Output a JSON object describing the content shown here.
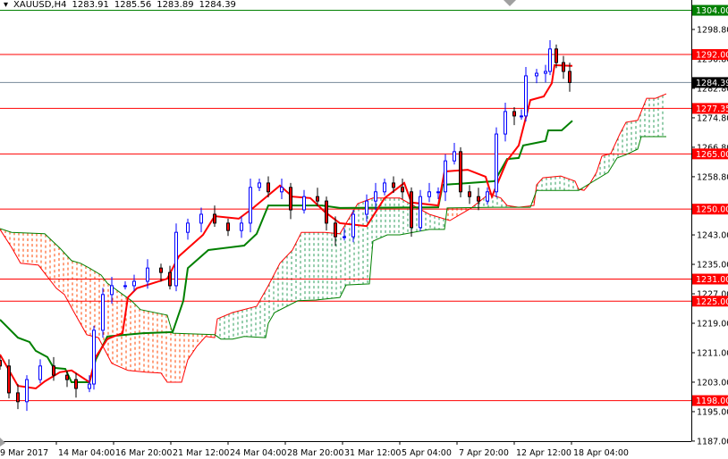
{
  "chart_data": {
    "type": "candlestick",
    "title": "XAUUSD,H4",
    "ohlc": [
      "1283.91",
      "1285.56",
      "1283.89",
      "1284.39"
    ],
    "ylim": [
      1185,
      1306.8
    ],
    "bar_count_visible": 130,
    "x_ticks": [
      "9 Mar 2017",
      "14 Mar 04:00",
      "16 Mar 20:00",
      "21 Mar 12:00",
      "24 Mar 04:00",
      "28 Mar 20:00",
      "31 Mar 12:00",
      "5 Apr 04:00",
      "7 Apr 20:00",
      "12 Apr 12:00",
      "18 Apr 04:00"
    ],
    "y_ticks": [
      "1298.80",
      "1290.80",
      "1282.80",
      "1274.80",
      "1266.80",
      "1258.80",
      "1243.00",
      "1235.00",
      "1227.00",
      "1219.00",
      "1211.00",
      "1203.00",
      "1195.00",
      "1187.00"
    ],
    "current_price": {
      "value": 1284.39,
      "label": "1284.39",
      "color": "#778899"
    },
    "levels": [
      {
        "value": 1304.0,
        "label": "1304.00",
        "color": "#008000"
      },
      {
        "value": 1292.0,
        "label": "1292.00",
        "color": "#ff0000"
      },
      {
        "value": 1277.35,
        "label": "1277.35",
        "color": "#ff0000"
      },
      {
        "value": 1265.0,
        "label": "1265.00",
        "color": "#ff0000"
      },
      {
        "value": 1250.0,
        "label": "1250.00",
        "color": "#ff0000"
      },
      {
        "value": 1231.0,
        "label": "1231.00",
        "color": "#ff0000"
      },
      {
        "value": 1225.0,
        "label": "1225.00",
        "color": "#ff0000"
      },
      {
        "value": 1198.0,
        "label": "1198.00",
        "color": "#ff0000"
      }
    ],
    "colors": {
      "bull": "#0000ff",
      "bear": "#ff0000",
      "tenkan": "#ff0000",
      "kijun": "#008000",
      "cloud_bull": "#2e9e5b",
      "cloud_bear": "#ff4500",
      "span_a": "#ff0000",
      "span_b": "#008000"
    },
    "closes": [
      [
        0,
        1207.4
      ],
      [
        2,
        1200.1
      ],
      [
        4,
        1197.7
      ],
      [
        6,
        1203.7
      ],
      [
        9,
        1207.4
      ],
      [
        12,
        1204.9
      ],
      [
        15,
        1203.7
      ],
      [
        17,
        1201.3
      ],
      [
        20,
        1202.5
      ],
      [
        21,
        1217.1
      ],
      [
        23,
        1226.8
      ],
      [
        25,
        1229.2
      ],
      [
        28,
        1229.2
      ],
      [
        30,
        1230.4
      ],
      [
        33,
        1234.0
      ],
      [
        36,
        1232.8
      ],
      [
        38,
        1229.2
      ],
      [
        39.4,
        1243.7
      ],
      [
        42,
        1246.2
      ],
      [
        45,
        1248.6
      ],
      [
        48,
        1246.2
      ],
      [
        51,
        1244.2
      ],
      [
        54,
        1246.2
      ],
      [
        56,
        1255.9
      ],
      [
        58,
        1257.1
      ],
      [
        60,
        1254.7
      ],
      [
        63,
        1255.9
      ],
      [
        65,
        1249.8
      ],
      [
        68,
        1253.4
      ],
      [
        71,
        1252.2
      ],
      [
        73,
        1246.2
      ],
      [
        75,
        1242.5
      ],
      [
        77,
        1242.5
      ],
      [
        79,
        1248.6
      ],
      [
        82,
        1252.2
      ],
      [
        84,
        1254.7
      ],
      [
        86,
        1257.1
      ],
      [
        88,
        1255.9
      ],
      [
        90,
        1254.7
      ],
      [
        92,
        1245.0
      ],
      [
        94,
        1253.4
      ],
      [
        96,
        1254.7
      ],
      [
        98,
        1254.7
      ],
      [
        99.6,
        1263.1
      ],
      [
        101.6,
        1265.6
      ],
      [
        103,
        1254.7
      ],
      [
        105,
        1253.4
      ],
      [
        107,
        1252.2
      ],
      [
        109,
        1254.7
      ],
      [
        111,
        1270.4
      ],
      [
        113,
        1276.5
      ],
      [
        115,
        1275.3
      ],
      [
        116.6,
        1275.3
      ],
      [
        117.6,
        1286.2
      ],
      [
        120,
        1286.9
      ],
      [
        122,
        1287.4
      ],
      [
        123,
        1293.5
      ],
      [
        124.4,
        1289.8
      ],
      [
        126,
        1287.4
      ],
      [
        127.4,
        1284.39
      ]
    ],
    "tenkan": [
      [
        0,
        1210.5
      ],
      [
        4,
        1202.0
      ],
      [
        8,
        1201.3
      ],
      [
        10,
        1203.2
      ],
      [
        13.4,
        1205.7
      ],
      [
        16,
        1206.2
      ],
      [
        20,
        1203.0
      ],
      [
        21.4,
        1209.8
      ],
      [
        24,
        1214.7
      ],
      [
        25.4,
        1215.4
      ],
      [
        27.4,
        1216.3
      ],
      [
        28.6,
        1226.0
      ],
      [
        30.6,
        1228.5
      ],
      [
        37.4,
        1231.1
      ],
      [
        40,
        1237.2
      ],
      [
        45.4,
        1243.0
      ],
      [
        48,
        1248.1
      ],
      [
        53.4,
        1247.4
      ],
      [
        56.6,
        1250.3
      ],
      [
        62.6,
        1256.4
      ],
      [
        65.4,
        1253.4
      ],
      [
        69.4,
        1253.0
      ],
      [
        72.6,
        1249.3
      ],
      [
        76,
        1246.2
      ],
      [
        82,
        1245.4
      ],
      [
        86,
        1253.0
      ],
      [
        90.4,
        1257.1
      ],
      [
        92,
        1251.8
      ],
      [
        98,
        1251.0
      ],
      [
        99.4,
        1260.2
      ],
      [
        104.6,
        1260.7
      ],
      [
        108.6,
        1258.8
      ],
      [
        110,
        1253.4
      ],
      [
        113.4,
        1263.2
      ],
      [
        116,
        1267.3
      ],
      [
        118.6,
        1279.6
      ],
      [
        121.6,
        1280.6
      ],
      [
        123.4,
        1284.2
      ],
      [
        124,
        1289.1
      ],
      [
        128,
        1288.9
      ]
    ],
    "kijun": [
      [
        0,
        1220.0
      ],
      [
        4,
        1215.1
      ],
      [
        6.6,
        1213.9
      ],
      [
        8,
        1211.5
      ],
      [
        10.6,
        1209.8
      ],
      [
        12,
        1206.9
      ],
      [
        14.6,
        1206.6
      ],
      [
        16,
        1203.0
      ],
      [
        20,
        1203.0
      ],
      [
        21.4,
        1209.1
      ],
      [
        24,
        1215.4
      ],
      [
        32,
        1216.3
      ],
      [
        38.6,
        1216.6
      ],
      [
        41,
        1225.1
      ],
      [
        42,
        1234.0
      ],
      [
        46.6,
        1238.9
      ],
      [
        54.6,
        1240.1
      ],
      [
        57.4,
        1243.3
      ],
      [
        60,
        1251.0
      ],
      [
        72,
        1251.0
      ],
      [
        76,
        1250.3
      ],
      [
        98,
        1250.5
      ],
      [
        99,
        1256.6
      ],
      [
        110.6,
        1257.6
      ],
      [
        113.4,
        1263.6
      ],
      [
        116,
        1263.9
      ],
      [
        117,
        1267.3
      ],
      [
        122,
        1268.5
      ],
      [
        122.6,
        1271.4
      ],
      [
        125.6,
        1271.4
      ],
      [
        128,
        1274.0
      ]
    ],
    "span_a": [
      [
        0,
        1244.5
      ],
      [
        2.6,
        1239.6
      ],
      [
        4.6,
        1235.3
      ],
      [
        8.6,
        1234.8
      ],
      [
        12.6,
        1228.5
      ],
      [
        14.4,
        1226.8
      ],
      [
        16.6,
        1221.9
      ],
      [
        19.4,
        1215.9
      ],
      [
        22,
        1215.1
      ],
      [
        25,
        1208.1
      ],
      [
        28.6,
        1206.2
      ],
      [
        32.6,
        1205.7
      ],
      [
        36,
        1205.5
      ],
      [
        37.4,
        1203.0
      ],
      [
        40.6,
        1203.0
      ],
      [
        42,
        1209.1
      ],
      [
        44,
        1212.7
      ],
      [
        46,
        1215.4
      ],
      [
        48,
        1215.1
      ],
      [
        48.6,
        1220.2
      ],
      [
        52,
        1221.9
      ],
      [
        57.4,
        1223.6
      ],
      [
        60,
        1229.2
      ],
      [
        62.6,
        1235.3
      ],
      [
        65.4,
        1238.9
      ],
      [
        67.4,
        1243.7
      ],
      [
        72.6,
        1243.7
      ],
      [
        76,
        1243.3
      ],
      [
        80,
        1251.5
      ],
      [
        83.4,
        1253.0
      ],
      [
        89.4,
        1253.0
      ],
      [
        96,
        1248.6
      ],
      [
        100.6,
        1246.9
      ],
      [
        105.4,
        1250.3
      ],
      [
        109.4,
        1254.2
      ],
      [
        112,
        1253.0
      ],
      [
        113.4,
        1251.0
      ],
      [
        116,
        1250.5
      ],
      [
        119.4,
        1251.0
      ],
      [
        120,
        1256.6
      ],
      [
        121.4,
        1258.5
      ],
      [
        125.4,
        1259.0
      ],
      [
        128.6,
        1257.6
      ],
      [
        129.4,
        1255.4
      ],
      [
        130.6,
        1255.1
      ],
      [
        132,
        1257.1
      ],
      [
        133.4,
        1260.0
      ],
      [
        134.6,
        1264.4
      ],
      [
        136.6,
        1265.1
      ],
      [
        138.6,
        1270.4
      ],
      [
        140,
        1273.6
      ],
      [
        142.6,
        1274.1
      ],
      [
        144.6,
        1280.1
      ],
      [
        146.6,
        1280.1
      ],
      [
        149,
        1281.3
      ]
    ],
    "span_b": [
      [
        0,
        1244.7
      ],
      [
        2.6,
        1243.7
      ],
      [
        10,
        1243.3
      ],
      [
        13.4,
        1239.4
      ],
      [
        16,
        1236.0
      ],
      [
        18,
        1235.3
      ],
      [
        20,
        1234.0
      ],
      [
        22.6,
        1232.1
      ],
      [
        24,
        1229.9
      ],
      [
        29.4,
        1225.1
      ],
      [
        31.4,
        1222.7
      ],
      [
        37.4,
        1221.2
      ],
      [
        38.6,
        1216.3
      ],
      [
        48,
        1215.9
      ],
      [
        49.4,
        1214.7
      ],
      [
        52,
        1214.7
      ],
      [
        54.6,
        1215.4
      ],
      [
        59.4,
        1215.1
      ],
      [
        60,
        1219.0
      ],
      [
        61.4,
        1221.9
      ],
      [
        66.6,
        1225.1
      ],
      [
        70.6,
        1225.3
      ],
      [
        76,
        1226.0
      ],
      [
        77.4,
        1229.4
      ],
      [
        82.6,
        1229.7
      ],
      [
        83.4,
        1241.3
      ],
      [
        86.6,
        1243.0
      ],
      [
        89.4,
        1243.0
      ],
      [
        96,
        1244.5
      ],
      [
        99.4,
        1244.5
      ],
      [
        100,
        1250.3
      ],
      [
        110.6,
        1250.5
      ],
      [
        118.6,
        1250.5
      ],
      [
        120,
        1255.1
      ],
      [
        129.4,
        1255.1
      ],
      [
        131.4,
        1256.6
      ],
      [
        136,
        1260.0
      ],
      [
        138,
        1263.9
      ],
      [
        140,
        1264.8
      ],
      [
        142.6,
        1266.3
      ],
      [
        143.4,
        1269.7
      ],
      [
        149,
        1269.7
      ]
    ]
  }
}
